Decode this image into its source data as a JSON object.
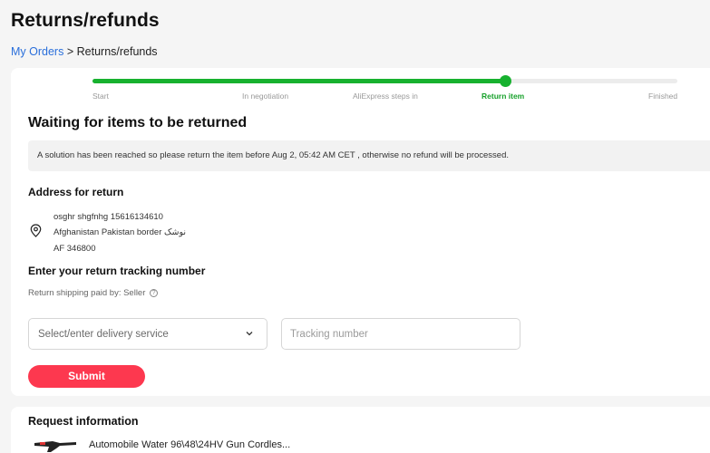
{
  "page": {
    "title": "Returns/refunds"
  },
  "breadcrumb": {
    "link": "My Orders",
    "separator": ">",
    "current": "Returns/refunds"
  },
  "progress": {
    "steps": [
      "Start",
      "In negotiation",
      "AliExpress steps in",
      "Return item",
      "Finished"
    ],
    "active_step": "Return item",
    "fraction_complete": 0.705,
    "accent_color": "#17b12f"
  },
  "status": {
    "heading": "Waiting for items to be returned",
    "notice": "A solution has been reached so please return the item before Aug 2, 05:42 AM CET , otherwise no refund will be processed."
  },
  "address": {
    "heading": "Address for return",
    "icon": "location-pin-icon",
    "name_phone": "osghr shgfnhg 15616134610",
    "line2": "Afghanistan Pakistan border نوشک",
    "line3": "AF 346800"
  },
  "tracking": {
    "heading": "Enter your return tracking number",
    "shipping_note": "Return shipping paid by: Seller",
    "delivery_placeholder": "Select/enter delivery service",
    "tracking_placeholder": "Tracking number",
    "submit_label": "Submit",
    "submit_color": "#fd384f"
  },
  "request": {
    "heading": "Request information",
    "product_title": "Automobile Water 96\\48\\24HV Gun Cordles..."
  }
}
